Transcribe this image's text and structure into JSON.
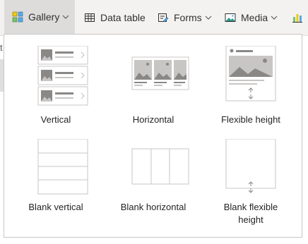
{
  "toolbar": {
    "items": [
      {
        "label": "Gallery",
        "icon": "gallery-icon",
        "has_dropdown": true,
        "active": true
      },
      {
        "label": "Data table",
        "icon": "data-table-icon",
        "has_dropdown": false
      },
      {
        "label": "Forms",
        "icon": "forms-icon",
        "has_dropdown": true
      },
      {
        "label": "Media",
        "icon": "media-icon",
        "has_dropdown": true
      },
      {
        "label": "",
        "icon": "chart-icon",
        "has_dropdown": false
      }
    ]
  },
  "background_fragment": "t",
  "gallery_menu": {
    "options": [
      {
        "label": "Vertical"
      },
      {
        "label": "Horizontal"
      },
      {
        "label": "Flexible height"
      },
      {
        "label": "Blank vertical"
      },
      {
        "label": "Blank horizontal"
      },
      {
        "label": "Blank flexible height"
      }
    ]
  },
  "colors": {
    "toolbar_bg": "#f3f2f1",
    "active_bg": "#dddcdb",
    "placeholder_gray": "#8a8886",
    "line_gray": "#c8c6c4"
  }
}
